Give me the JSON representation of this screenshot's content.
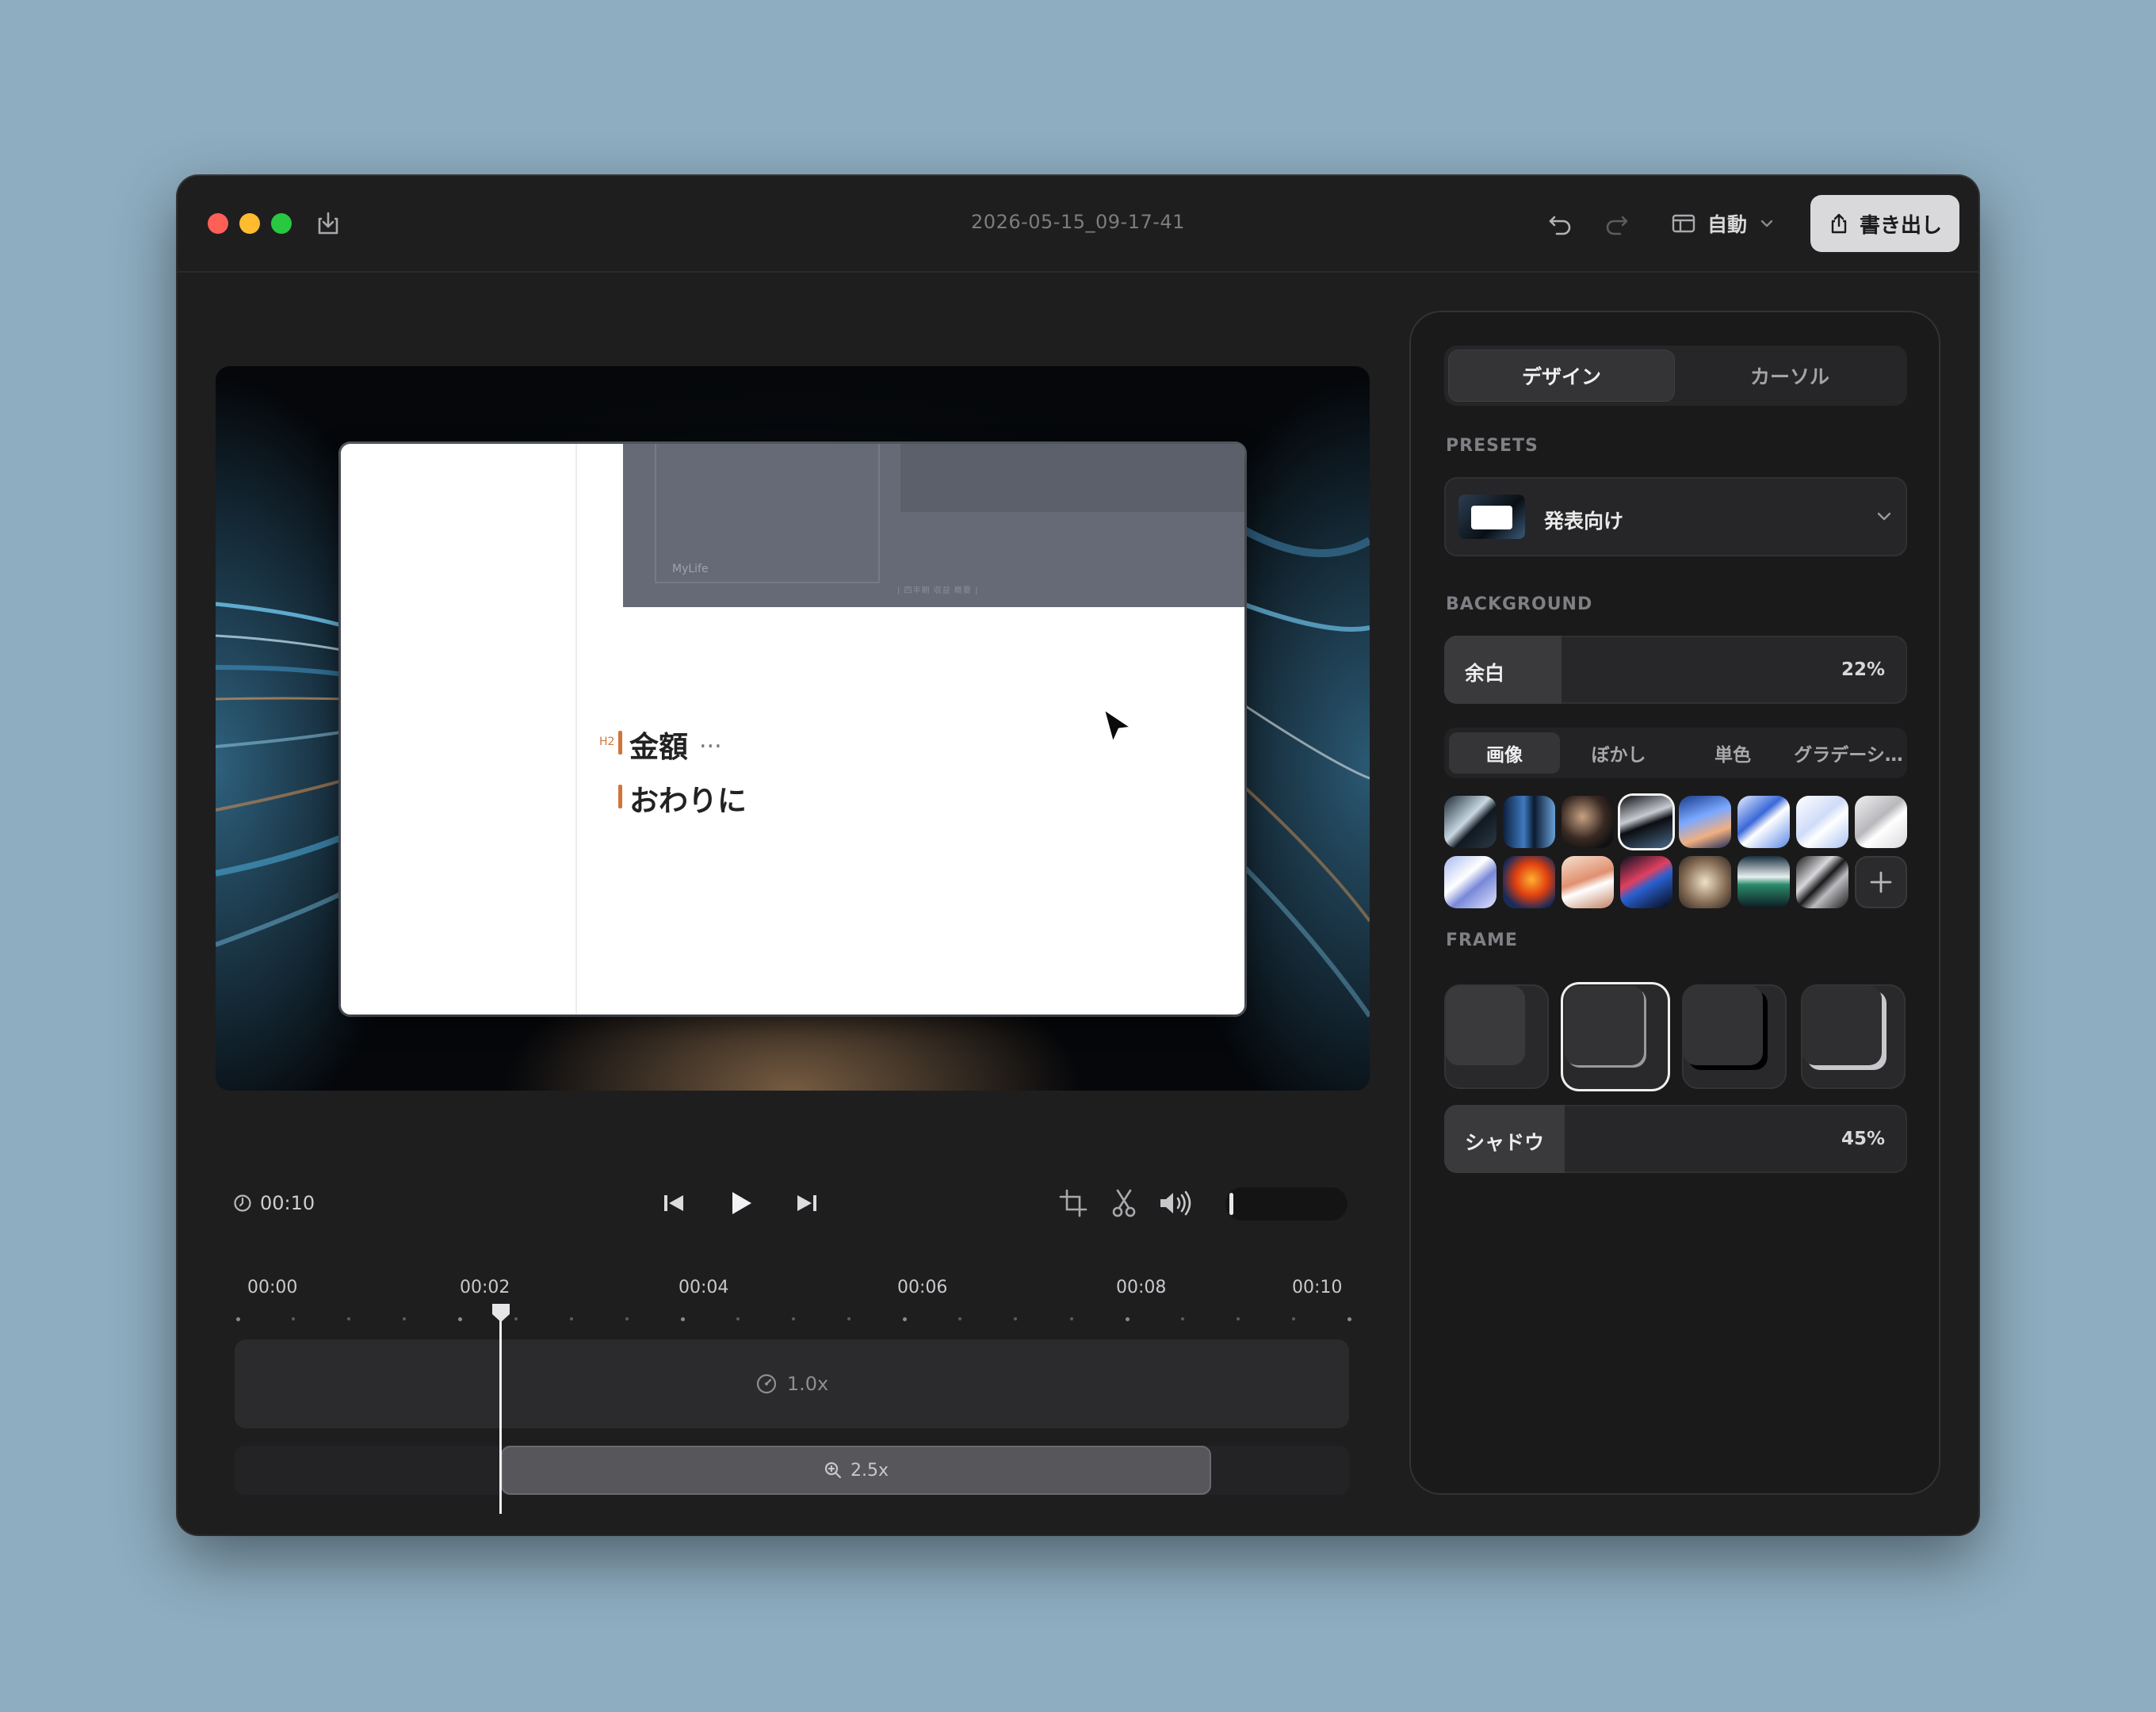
{
  "window": {
    "title": "2026-05-15_09-17-41",
    "layout_mode": "自動",
    "export_label": "書き出し"
  },
  "colors": {
    "accent_orange": "#d0753a",
    "export_bg": "#d9d9db",
    "desktop": "#8eadc0"
  },
  "canvas": {
    "app_label": "MyLife",
    "tiny_text": "| 四半期 収益 概要 |",
    "h2_tag": "H2",
    "heading1": "金額",
    "heading1_suffix": "...",
    "heading2": "おわりに"
  },
  "transport": {
    "duration": "00:10",
    "volume": 0.02
  },
  "timeline": {
    "ruler": [
      "00:00",
      "00:02",
      "00:04",
      "00:06",
      "00:08",
      "00:10"
    ],
    "speed_label": "1.0x",
    "zoom_label": "2.5x",
    "playhead_time": "00:02"
  },
  "panel": {
    "tabs": [
      {
        "label": "デザイン",
        "active": true
      },
      {
        "label": "カーソル",
        "active": false
      }
    ],
    "presets_header": "PRESETS",
    "preset_name": "発表向け",
    "background_header": "BACKGROUND",
    "padding": {
      "label": "余白",
      "value": "22%",
      "fraction": 0.22
    },
    "bg_tabs": [
      {
        "label": "画像",
        "active": true
      },
      {
        "label": "ぼかし",
        "active": false
      },
      {
        "label": "単色",
        "active": false
      },
      {
        "label": "グラデーシ…",
        "active": false
      }
    ],
    "selected_wallpaper": 3,
    "frame_header": "FRAME",
    "selected_frame": 1,
    "shadow": {
      "label": "シャドウ",
      "value": "45%",
      "fraction": 0.45
    }
  },
  "icons": {
    "save": "download-tray-icon",
    "undo": "undo-arrow-icon",
    "redo": "redo-arrow-icon",
    "layout": "layout-panel-icon",
    "export": "share-up-icon",
    "clock": "clock-icon",
    "speed": "speedometer-icon",
    "zoom": "magnifier-plus-icon"
  }
}
